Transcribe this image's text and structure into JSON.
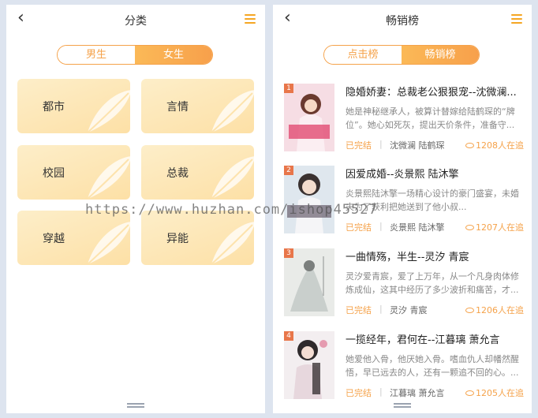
{
  "left_panel": {
    "title": "分类",
    "tabs": [
      {
        "label": "男生"
      },
      {
        "label": "女生"
      }
    ],
    "active_tab": "女生",
    "categories": [
      {
        "label": "都市"
      },
      {
        "label": "言情"
      },
      {
        "label": "校园"
      },
      {
        "label": "总裁"
      },
      {
        "label": "穿越"
      },
      {
        "label": "异能"
      }
    ]
  },
  "right_panel": {
    "title": "畅销榜",
    "tabs": [
      {
        "label": "点击榜"
      },
      {
        "label": "畅销榜"
      }
    ],
    "active_tab": "畅销榜",
    "books": [
      {
        "rank": "1",
        "title": "隐婚娇妻：总裁老公狠狠宠--沈微澜...",
        "desc": "她是神秘继承人，被算计替嫁给陆鹤琛的“牌位”。她心如死灰，提出天价条件，准备守...",
        "status": "已完结",
        "author": "沈微澜 陆鹤琛",
        "readers": "1208人在追"
      },
      {
        "rank": "2",
        "title": "因爱成婚--炎景熙 陆沐擎",
        "desc": "炎景熙陆沐擎一场精心设计的豪门盛宴，未婚夫为了获利把她送到了他小叔...",
        "status": "已完结",
        "author": "炎景熙 陆沐擎",
        "readers": "1207人在追"
      },
      {
        "rank": "3",
        "title": "一曲情殇，半生--灵汐 青宸",
        "desc": "灵汐爱青宸，爱了上万年，从一个凡身肉体修炼成仙，这其中经历了多少波折和痛苦，才...",
        "status": "已完结",
        "author": "灵汐 青宸",
        "readers": "1206人在追"
      },
      {
        "rank": "4",
        "title": "一揽经年，君何在--江暮璃 萧允言",
        "desc": "她爱他入骨，他厌她入骨。嗜血仇人却幡然醒悟，早已远去的人，还有一颗追不回的心。...",
        "status": "已完结",
        "author": "江暮璃 萧允言",
        "readers": "1205人在追"
      }
    ]
  },
  "watermark": "https://www.huzhan.com/ishop45527",
  "colors": {
    "accent": "#f5a24a",
    "tile": "#fde7b7"
  }
}
